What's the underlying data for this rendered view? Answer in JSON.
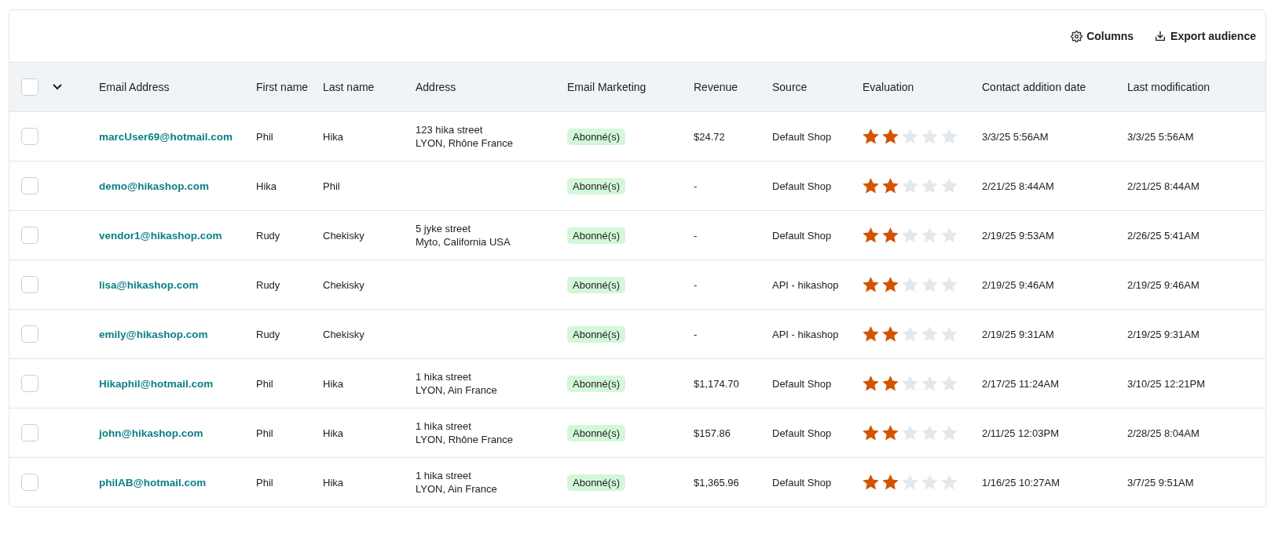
{
  "toolbar": {
    "buttons": [
      {
        "kind": "columns",
        "label": "Columns"
      },
      {
        "kind": "export",
        "label": "Export audience"
      }
    ]
  },
  "table": {
    "select_all": {
      "checked": false
    },
    "columns": [
      "Email Address",
      "First name",
      "Last name",
      "Address",
      "Email Marketing",
      "Revenue",
      "Source",
      "Evaluation",
      "Contact addition date",
      "Last modification"
    ],
    "rows": [
      {
        "checked": false,
        "email": "marcUser69@hotmail.com",
        "first_name": "Phil",
        "last_name": "Hika",
        "address": [
          "123 hika street",
          "LYON, Rhône France"
        ],
        "marketing": "Abonné(s)",
        "revenue": "$24.72",
        "source": "Default Shop",
        "stars": 2,
        "added": "3/3/25 5:56AM",
        "modified": "3/3/25 5:56AM"
      },
      {
        "checked": false,
        "email": "demo@hikashop.com",
        "first_name": "Hika",
        "last_name": "Phil",
        "marketing": "Abonné(s)",
        "revenue": "-",
        "source": "Default Shop",
        "stars": 2,
        "added": "2/21/25 8:44AM",
        "modified": "2/21/25 8:44AM"
      },
      {
        "checked": false,
        "email": "vendor1@hikashop.com",
        "first_name": "Rudy",
        "last_name": "Chekisky",
        "address": [
          "5 jyke street",
          "Myto, California  USA"
        ],
        "marketing": "Abonné(s)",
        "revenue": "-",
        "source": "Default Shop",
        "stars": 2,
        "added": "2/19/25 9:53AM",
        "modified": "2/26/25 5:41AM"
      },
      {
        "checked": false,
        "email": "lisa@hikashop.com",
        "first_name": "Rudy",
        "last_name": "Chekisky",
        "marketing": "Abonné(s)",
        "revenue": "-",
        "source": "API - hikashop",
        "stars": 2,
        "added": "2/19/25 9:46AM",
        "modified": "2/19/25 9:46AM"
      },
      {
        "checked": false,
        "email": "emily@hikashop.com",
        "first_name": "Rudy",
        "last_name": "Chekisky",
        "marketing": "Abonné(s)",
        "revenue": "-",
        "source": "API - hikashop",
        "stars": 2,
        "added": "2/19/25 9:31AM",
        "modified": "2/19/25 9:31AM"
      },
      {
        "checked": false,
        "email": "Hikaphil@hotmail.com",
        "first_name": "Phil",
        "last_name": "Hika",
        "address": [
          "1 hika street",
          "LYON, Ain France"
        ],
        "marketing": "Abonné(s)",
        "revenue": "$1,174.70",
        "source": "Default Shop",
        "stars": 2,
        "added": "2/17/25 11:24AM",
        "modified": "3/10/25 12:21PM"
      },
      {
        "checked": false,
        "email": "john@hikashop.com",
        "first_name": "Phil",
        "last_name": "Hika",
        "address": [
          "1 hika street",
          "LYON, Rhône France"
        ],
        "marketing": "Abonné(s)",
        "revenue": "$157.86",
        "source": "Default Shop",
        "stars": 2,
        "added": "2/11/25 12:03PM",
        "modified": "2/28/25 8:04AM"
      },
      {
        "checked": false,
        "email": "philAB@hotmail.com",
        "first_name": "Phil",
        "last_name": "Hika",
        "address": [
          "1 hika street",
          "LYON, Ain France"
        ],
        "marketing": "Abonné(s)",
        "revenue": "$1,365.96",
        "source": "Default Shop",
        "stars": 2,
        "added": "1/16/25 10:27AM",
        "modified": "3/7/25 9:51AM"
      }
    ]
  }
}
